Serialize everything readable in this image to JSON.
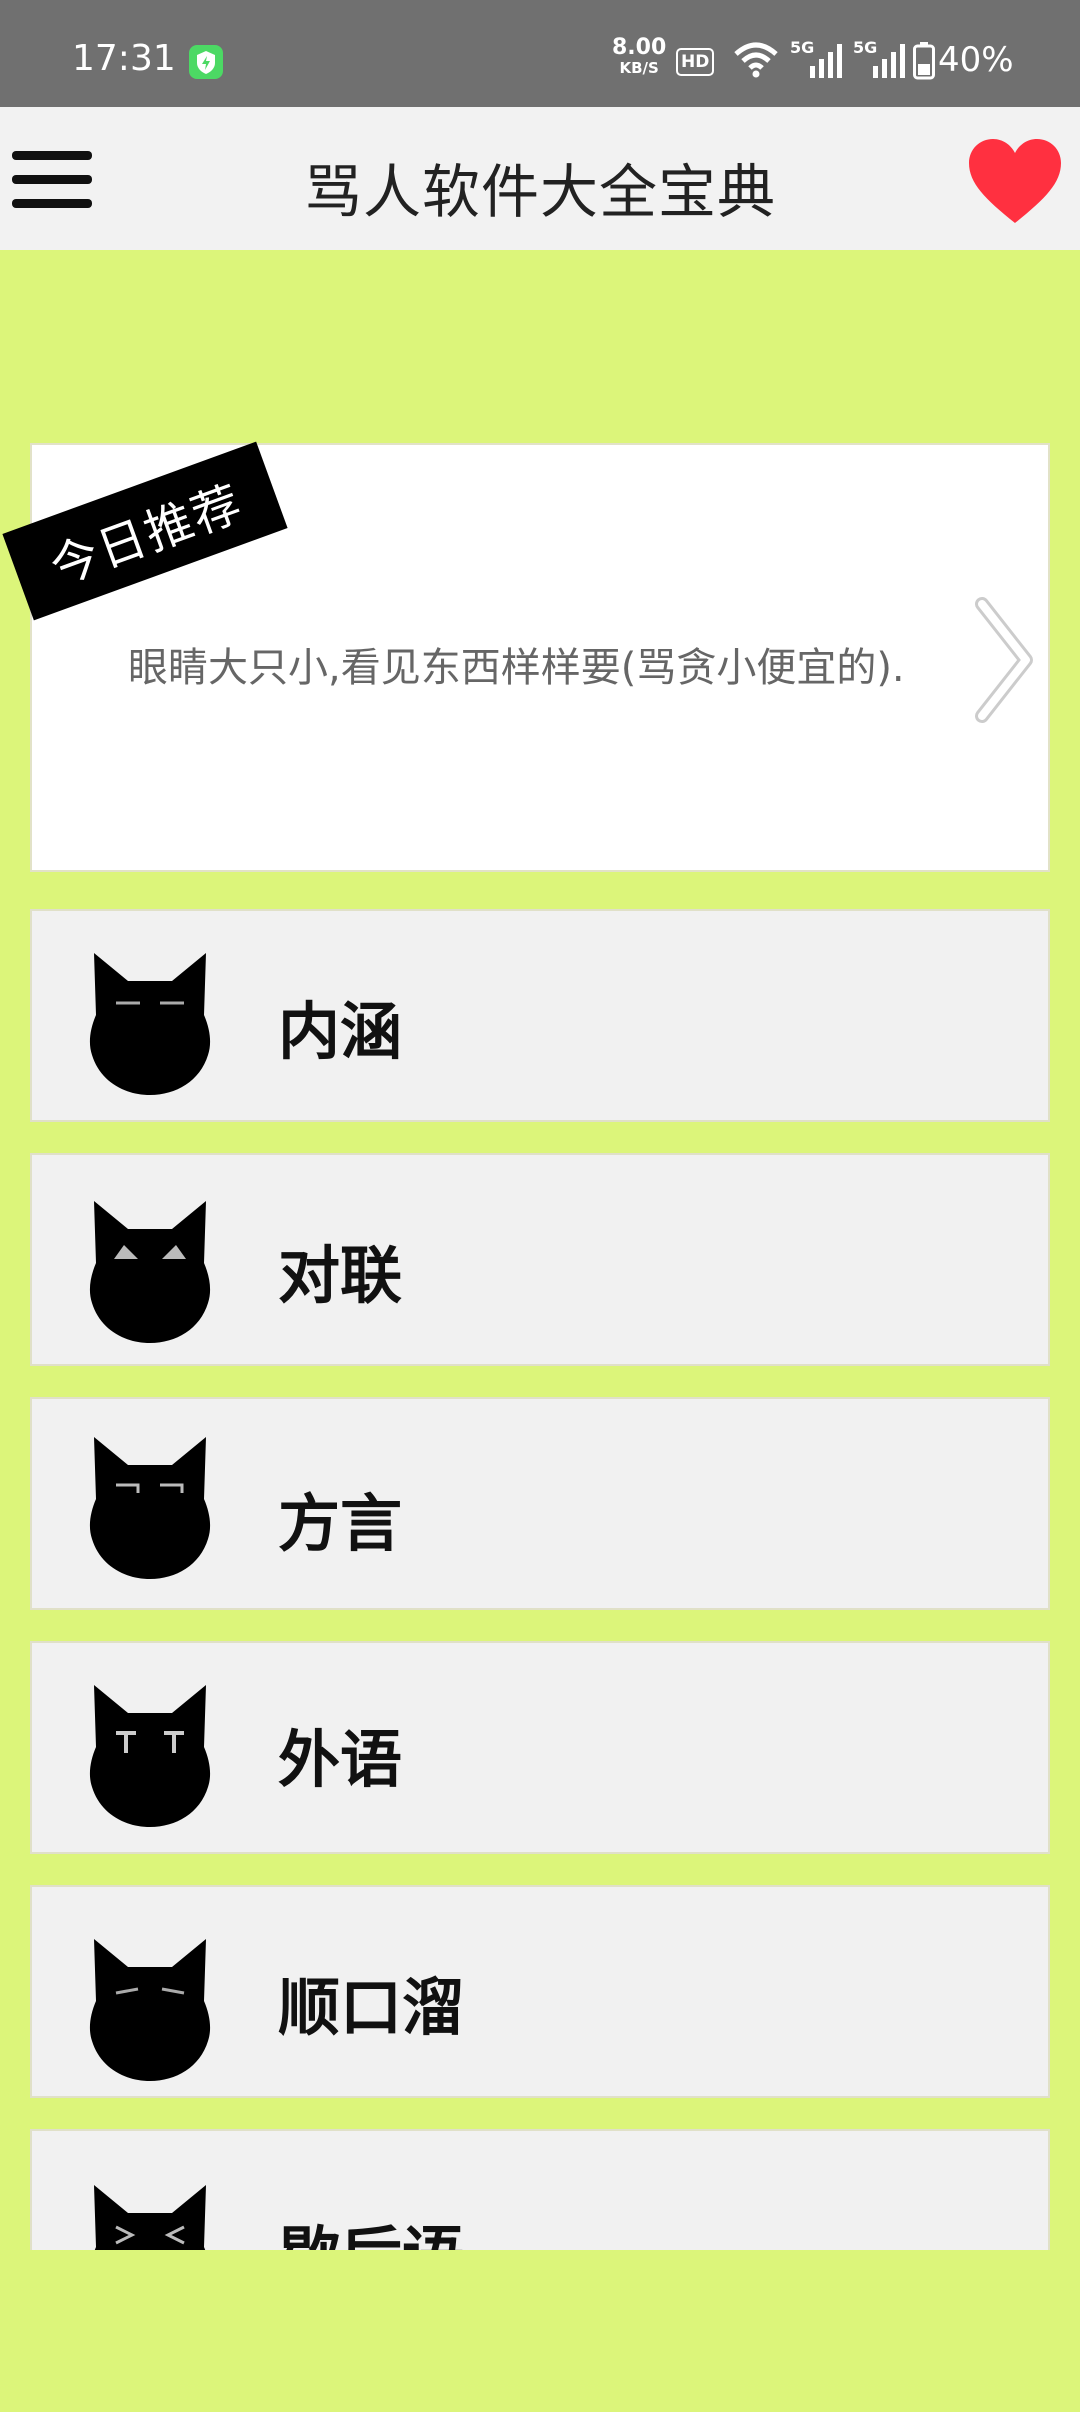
{
  "status_bar": {
    "time": "17:31",
    "net_speed": "8.00",
    "net_speed_unit": "KB/S",
    "hd": "HD",
    "signal_1": "5G",
    "signal_2": "5G",
    "battery": "40%"
  },
  "app_bar": {
    "title": "骂人软件大全宝典",
    "menu_icon": "hamburger-menu-icon",
    "favorite_icon": "heart-icon"
  },
  "recommendation": {
    "badge": "今日推荐",
    "text": "眼睛大只小,看见东西样样要(骂贪小便宜的).",
    "arrow_icon": "chevron-right-icon"
  },
  "categories": [
    {
      "label": "内涵",
      "icon": "cat-face-icon"
    },
    {
      "label": "对联",
      "icon": "cat-face-icon"
    },
    {
      "label": "方言",
      "icon": "cat-face-icon"
    },
    {
      "label": "外语",
      "icon": "cat-face-icon"
    },
    {
      "label": "顺口溜",
      "icon": "cat-face-icon"
    },
    {
      "label": "歇后语",
      "icon": "cat-face-icon"
    }
  ],
  "colors": {
    "background": "#dcf57a",
    "status_bar": "#707070",
    "app_bar": "#f2f2f2",
    "heart": "#ff3040",
    "card": "#ffffff",
    "list_item": "#f1f1f1"
  }
}
